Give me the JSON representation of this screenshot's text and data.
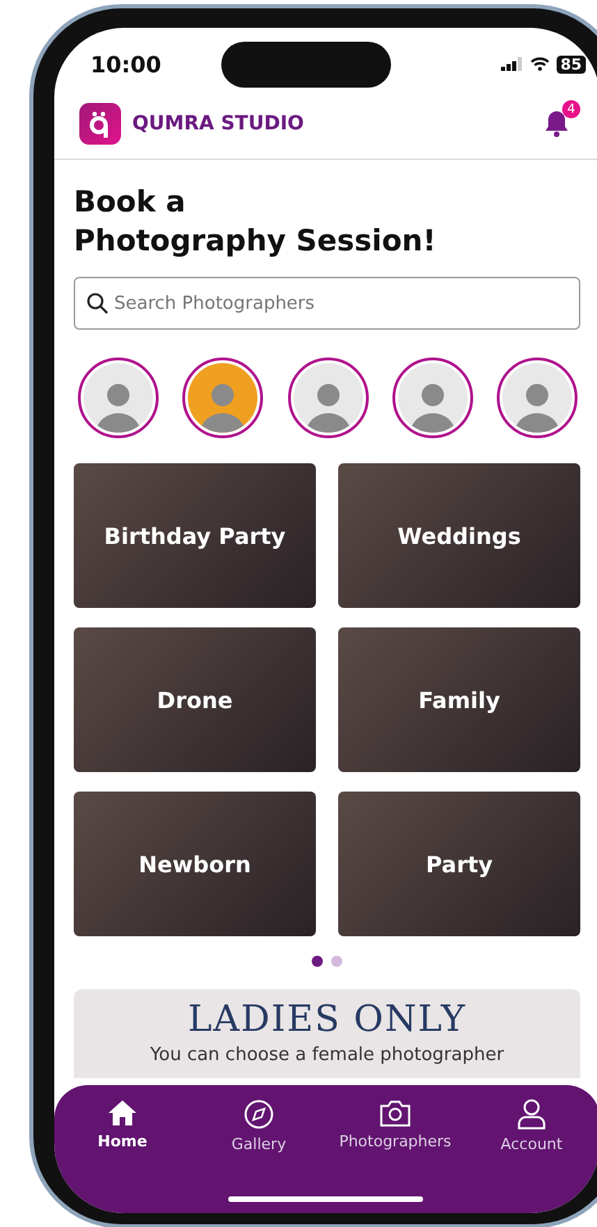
{
  "status_bar": {
    "time": "10:00",
    "battery": "85"
  },
  "header": {
    "brand": "QUMRA STUDIO",
    "notifications": "4"
  },
  "title": "Book a\nPhotography Session!",
  "search": {
    "placeholder": "Search Photographers"
  },
  "photographers": [
    {
      "color": "#e8e8e8"
    },
    {
      "color": "#f0a020"
    },
    {
      "color": "#e8e8e8"
    },
    {
      "color": "#e8e8e8"
    },
    {
      "color": "#e8e8e8"
    }
  ],
  "categories": [
    {
      "label": "Birthday Party"
    },
    {
      "label": "Weddings"
    },
    {
      "label": "Drone"
    },
    {
      "label": "Family"
    },
    {
      "label": "Newborn"
    },
    {
      "label": "Party"
    }
  ],
  "pager": [
    {
      "selected": true
    },
    {
      "selected": false
    }
  ],
  "promo": {
    "title": "LADIES ONLY",
    "subtitle": "You can choose a female photographer"
  },
  "tab_bar": [
    {
      "kind": "home",
      "label": "Home",
      "selected": true
    },
    {
      "kind": "gallery",
      "label": "Gallery",
      "selected": false
    },
    {
      "kind": "camera",
      "label": "Photographers",
      "selected": false
    },
    {
      "kind": "account",
      "label": "Account",
      "selected": false
    }
  ]
}
